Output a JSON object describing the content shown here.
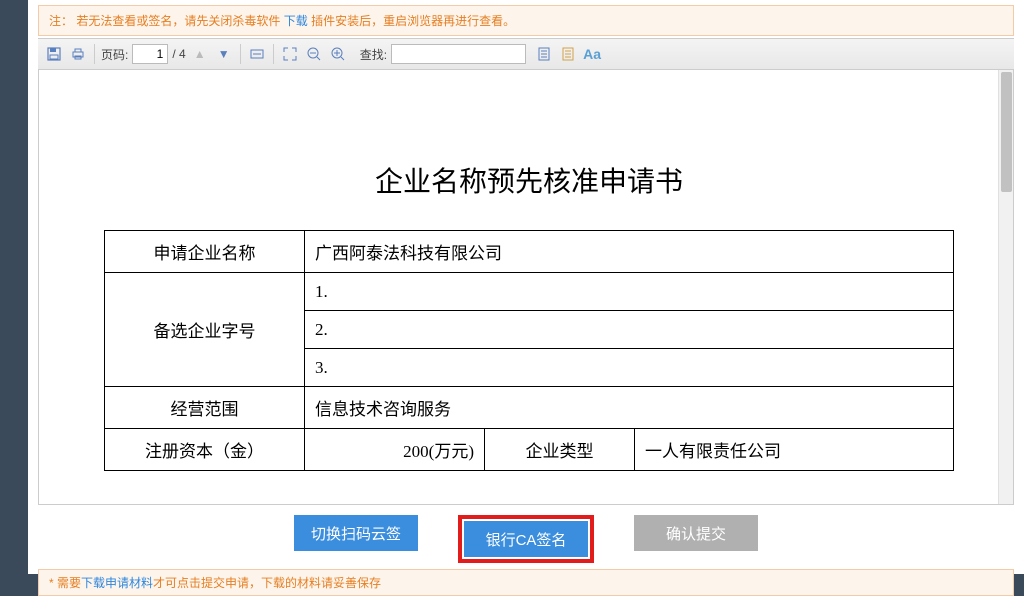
{
  "notice": {
    "prefix": "注：",
    "text1": "若无法查看或签名，请先关闭杀毒软件",
    "link": "下载",
    "text2": "插件安装后，重启浏览器再进行查看。"
  },
  "toolbar": {
    "page_label": "页码:",
    "page_current": "1",
    "page_total": "/ 4",
    "search_label": "查找:"
  },
  "document": {
    "title": "企业名称预先核准申请书",
    "rows": {
      "r1": {
        "label": "申请企业名称",
        "value": "广西阿泰法科技有限公司"
      },
      "r2": {
        "label": "备选企业字号",
        "v1": "1.",
        "v2": "2.",
        "v3": "3."
      },
      "r3": {
        "label": "经营范围",
        "value": "信息技术咨询服务"
      },
      "r4": {
        "label": "注册资本（金）",
        "value": "200(万元)",
        "label2": "企业类型",
        "value2": "一人有限责任公司"
      }
    }
  },
  "actions": {
    "switch": "切换扫码云签",
    "bankca": "银行CA签名",
    "submit": "确认提交"
  },
  "footnote": {
    "star": "* 需要",
    "link": "下载申请材料",
    "rest": "才可点击提交申请，下载的材料请妥善保存"
  }
}
